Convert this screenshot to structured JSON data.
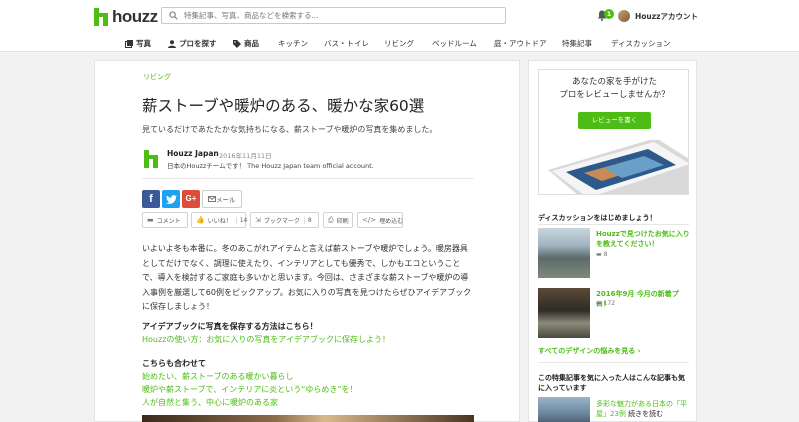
{
  "header": {
    "logo": "houzz",
    "search_placeholder": "特集記事、写真、商品などを検索する...",
    "notification_count": "1",
    "account": "Houzzアカウント"
  },
  "nav": {
    "items": [
      {
        "label": "写真"
      },
      {
        "label": "プロを探す"
      },
      {
        "label": "商品"
      },
      {
        "label": "キッチン"
      },
      {
        "label": "バス・トイレ"
      },
      {
        "label": "リビング"
      },
      {
        "label": "ベッドルーム"
      },
      {
        "label": "庭・アウトドア"
      },
      {
        "label": "特集記事"
      },
      {
        "label": "ディスカッション"
      }
    ]
  },
  "article": {
    "category": "リビング",
    "title": "薪ストーブや暖炉のある、暖かな家60選",
    "subtitle": "見ているだけであたたかな気持ちになる、薪ストーブや暖炉の写真を集めました。",
    "author": {
      "name": "Houzz Japan",
      "date": "2016年11月11日",
      "description": "日本のHouzzチームです！ The Houzz Japan team official account."
    },
    "share": {
      "facebook": "f",
      "google_plus": "G+",
      "mail": "メール"
    },
    "actions": {
      "comment": "コメント",
      "like": "いいね！",
      "like_count": "14",
      "bookmark": "ブックマーク",
      "bookmark_count": "8",
      "print": "印刷",
      "embed": "埋め込む"
    },
    "intro": "いよいよ冬も本番に。冬のあこがれアイテムと言えば薪ストーブや暖炉でしょう。暖房器具としてだけでなく、調理に使えたり、インテリアとしても優秀で、しかもエコということで、導入を検討するご家庭も多いかと思います。今回は、さまざまな薪ストーブや暖炉の導入事例を厳選して60例をピックアップ。お気に入りの写真を見つけたらぜひアイデアブックに保存しましょう！",
    "ideabook_heading": "アイデアブックに写真を保存する方法はこちら！",
    "ideabook_link": "Houzzの使い方：お気に入りの写真をアイデアブックに保存しよう！",
    "related_heading": "こちらも合わせて",
    "related_links": [
      "始めたい、薪ストーブのある暖かい暮らし",
      "暖炉や薪ストーブで、インテリアに炎という“ゆらめき”を！",
      "人が自然と集う、中心に暖炉のある家"
    ]
  },
  "sidebar": {
    "promo_text": "あなたの家を手がけた\nプロをレビューしませんか？",
    "promo_button": "レビューを書く",
    "discussion_heading": "ディスカッションをはじめましょう！",
    "discussions": [
      {
        "title": "Houzzで見つけたお気に入りを教えてください！",
        "count": "8"
      },
      {
        "title": "2016年9月 今月の新着プロ！",
        "count": "172"
      }
    ],
    "design_more": "すべてのデザインの悩みを見る",
    "also_liked_heading": "この特集記事を気に入った人はこんな記事も気に入っています",
    "also_liked": {
      "title_green": "多彩な魅力がある日本の「平屋」23例",
      "title_rest": " 続きを読む"
    }
  },
  "colors": {
    "brand": "#4dbc15",
    "facebook": "#3b5998",
    "twitter": "#1da1f2",
    "google_plus": "#dd4b39"
  }
}
